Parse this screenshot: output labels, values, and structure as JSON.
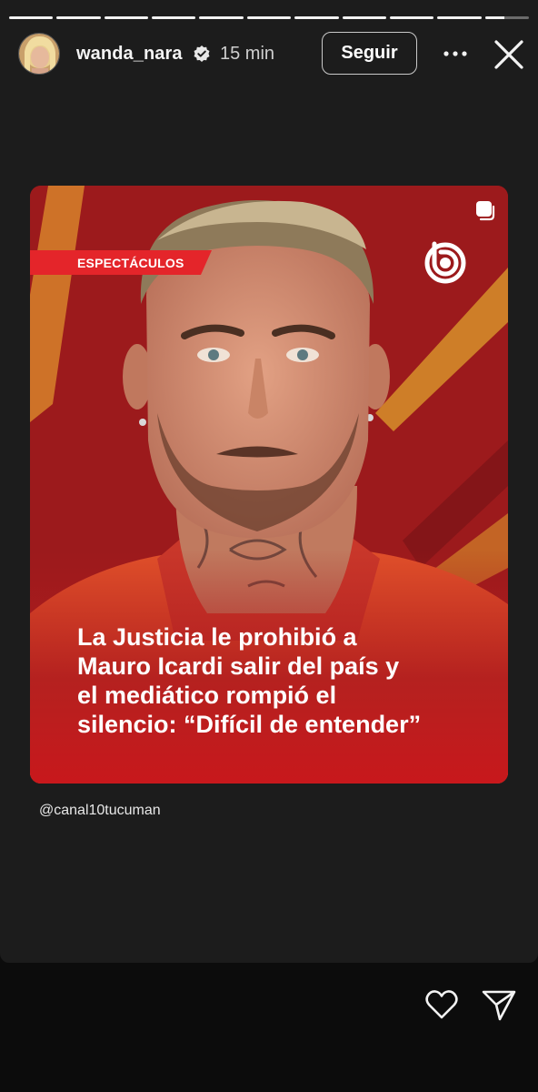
{
  "story": {
    "segments_total": 11,
    "segments_viewed": 10,
    "current_segment_progress": 0.45,
    "username": "wanda_nara",
    "verified": true,
    "time_ago": "15 min",
    "follow_label": "Seguir"
  },
  "post": {
    "category": "ESPECTÁCULOS",
    "headline_lines": [
      "La Justicia le prohibió a",
      "Mauro Icardi salir del país y",
      "el mediático rompió el",
      "silencio: “Difícil de entender”"
    ],
    "mention": "@canal10tucuman"
  },
  "colors": {
    "background": "#1c1c1c",
    "post_red": "#a0181a",
    "category_red": "#e4252a",
    "accent_orange": "#e08a1e"
  },
  "icons": {
    "header": [
      "verified-badge-icon",
      "more-options-icon",
      "close-icon"
    ],
    "post": [
      "multiple-posts-icon",
      "channel-logo-icon"
    ],
    "footer": [
      "heart-icon",
      "send-icon"
    ]
  }
}
